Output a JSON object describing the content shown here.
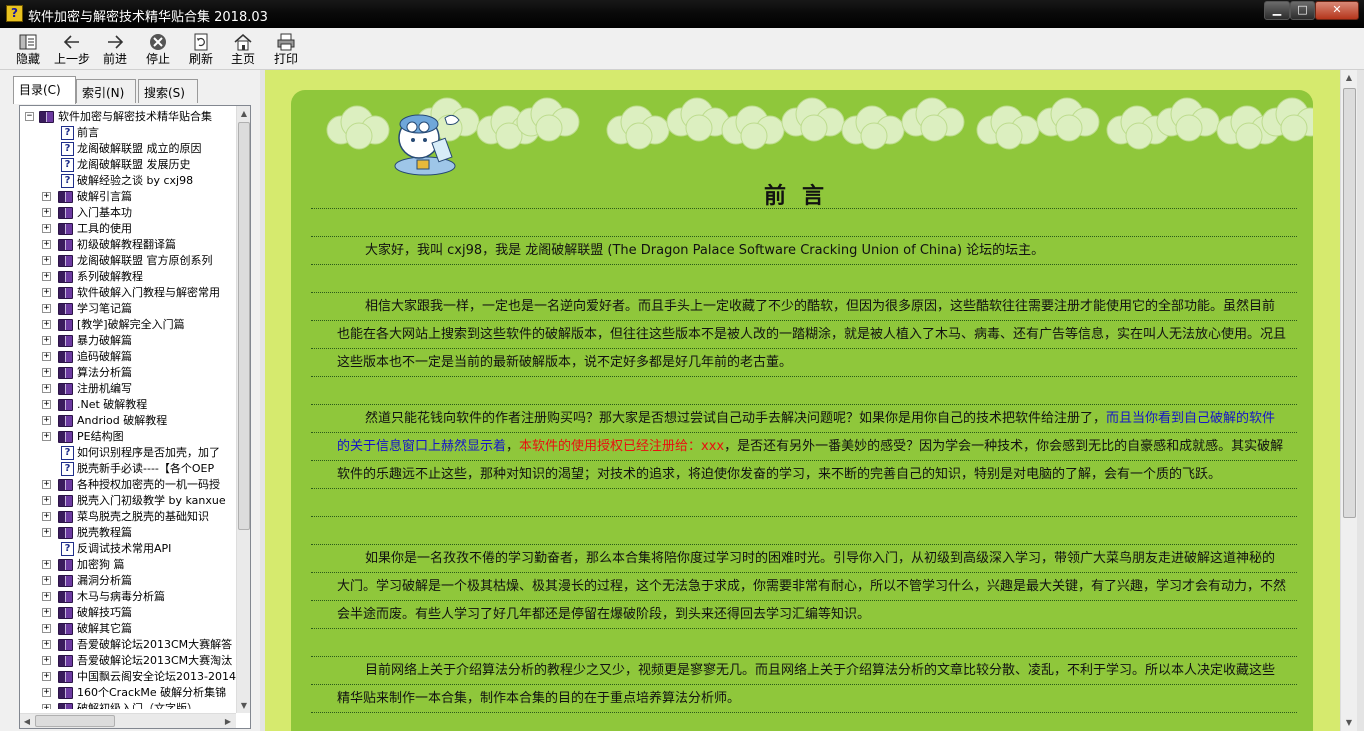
{
  "window": {
    "title": "软件加密与解密技术精华贴合集 2018.03",
    "app_icon": "?",
    "min": "▁",
    "max": "□",
    "close": "✕"
  },
  "toolbar": [
    {
      "key": "hide",
      "label": "隐藏",
      "icon": "hide-icon"
    },
    {
      "key": "back",
      "label": "上一步",
      "icon": "arrow-left-icon"
    },
    {
      "key": "forward",
      "label": "前进",
      "icon": "arrow-right-icon"
    },
    {
      "key": "stop",
      "label": "停止",
      "icon": "stop-icon"
    },
    {
      "key": "refresh",
      "label": "刷新",
      "icon": "refresh-icon"
    },
    {
      "key": "home",
      "label": "主页",
      "icon": "home-icon"
    },
    {
      "key": "print",
      "label": "打印",
      "icon": "print-icon"
    }
  ],
  "tabs": [
    "目录(C)",
    "索引(N)",
    "搜索(S)"
  ],
  "tree": [
    {
      "type": "root",
      "label": "软件加密与解密技术精华贴合集"
    },
    {
      "type": "page",
      "label": "前言"
    },
    {
      "type": "page",
      "label": "龙阁破解联盟 成立的原因"
    },
    {
      "type": "page",
      "label": "龙阁破解联盟 发展历史"
    },
    {
      "type": "page",
      "label": "破解经验之谈 by cxj98"
    },
    {
      "type": "book",
      "label": "破解引言篇"
    },
    {
      "type": "book",
      "label": "入门基本功"
    },
    {
      "type": "book",
      "label": "工具的使用"
    },
    {
      "type": "book",
      "label": "初级破解教程翻译篇"
    },
    {
      "type": "book",
      "label": "龙阁破解联盟 官方原创系列"
    },
    {
      "type": "book",
      "label": "系列破解教程"
    },
    {
      "type": "book",
      "label": "软件破解入门教程与解密常用"
    },
    {
      "type": "book",
      "label": "学习笔记篇"
    },
    {
      "type": "book",
      "label": "[教学]破解完全入门篇"
    },
    {
      "type": "book",
      "label": "暴力破解篇"
    },
    {
      "type": "book",
      "label": "追码破解篇"
    },
    {
      "type": "book",
      "label": "算法分析篇"
    },
    {
      "type": "book",
      "label": "注册机编写"
    },
    {
      "type": "book",
      "label": ".Net 破解教程"
    },
    {
      "type": "book",
      "label": "Andriod 破解教程"
    },
    {
      "type": "book",
      "label": "PE结构图"
    },
    {
      "type": "page",
      "label": "如何识别程序是否加壳，加了"
    },
    {
      "type": "page",
      "label": "脱壳新手必读----【各个OEP"
    },
    {
      "type": "book",
      "label": "各种授权加密壳的一机一码授"
    },
    {
      "type": "book",
      "label": "脱壳入门初级教学 by kanxue"
    },
    {
      "type": "book",
      "label": "菜鸟脱壳之脱壳的基础知识"
    },
    {
      "type": "book",
      "label": "脱壳教程篇"
    },
    {
      "type": "page",
      "label": "反调试技术常用API"
    },
    {
      "type": "book",
      "label": "加密狗 篇"
    },
    {
      "type": "book",
      "label": "漏洞分析篇"
    },
    {
      "type": "book",
      "label": "木马与病毒分析篇"
    },
    {
      "type": "book",
      "label": "破解技巧篇"
    },
    {
      "type": "book",
      "label": "破解其它篇"
    },
    {
      "type": "book",
      "label": "吾爱破解论坛2013CM大赛解答"
    },
    {
      "type": "book",
      "label": "吾爱破解论坛2013CM大赛淘汰"
    },
    {
      "type": "book",
      "label": "中国飘云阁安全论坛2013-2014"
    },
    {
      "type": "book",
      "label": "160个CrackMe 破解分析集锦"
    },
    {
      "type": "book",
      "label": "破解初级入门（文字版）"
    }
  ],
  "content": {
    "title": "前言",
    "p1": "大家好，我叫 cxj98，我是 龙阁破解联盟 (The Dragon Palace Software Cracking Union of China) 论坛的坛主。",
    "p2": "相信大家跟我一样，一定也是一名逆向爱好者。而且手头上一定收藏了不少的酷软，但因为很多原因，这些酷软往往需要注册才能使用它的全部功能。虽然目前也能在各大网站上搜索到这些软件的破解版本，但往往这些版本不是被人改的一踏糊涂，就是被人植入了木马、病毒、还有广告等信息，实在叫人无法放心使用。况且这些版本也不一定是当前的最新破解版本，说不定好多都是好几年前的老古董。",
    "p3a": "然道只能花钱向软件的作者注册购买吗？那大家是否想过尝试自己动手去解决问题呢？如果你是用你自己的技术把软件给注册了，",
    "p3b": "而且当你看到自己破解的软件的关于信息窗口上赫然显示着",
    "p3c": "，",
    "p3d": "本软件的使用授权已经注册给：xxx",
    "p3e": "，是否还有另外一番美妙的感受？因为学会一种技术，你会感到无比的自豪感和成就感。其实破解软件的乐趣远不止这些，那种对知识的渴望；对技术的追求，将迫使你发奋的学习，来不断的完善自己的知识，特别是对电脑的了解，会有一个质的飞跃。",
    "p4": "如果你是一名孜孜不倦的学习勤奋者，那么本合集将陪你度过学习时的困难时光。引导你入门，从初级到高级深入学习，带领广大菜鸟朋友走进破解这道神秘的大门。学习破解是一个极其枯燥、极其漫长的过程，这个无法急于求成，你需要非常有耐心，所以不管学习什么，兴趣是最大关键，有了兴趣，学习才会有动力，不然会半途而废。有些人学习了好几年都还是停留在爆破阶段，到头来还得回去学习汇编等知识。",
    "p5": "目前网络上关于介绍算法分析的教程少之又少，视频更是寥寥无几。而且网络上关于介绍算法分析的文章比较分散、凌乱，不利于学习。所以本人决定收藏这些精华贴来制作一本合集，制作本合集的目的在于重点培养算法分析师。"
  },
  "colors": {
    "panel": "#8fc73b",
    "outer": "#d6ea6e",
    "link_blue": "#1515c8",
    "link_red": "#e81010"
  }
}
